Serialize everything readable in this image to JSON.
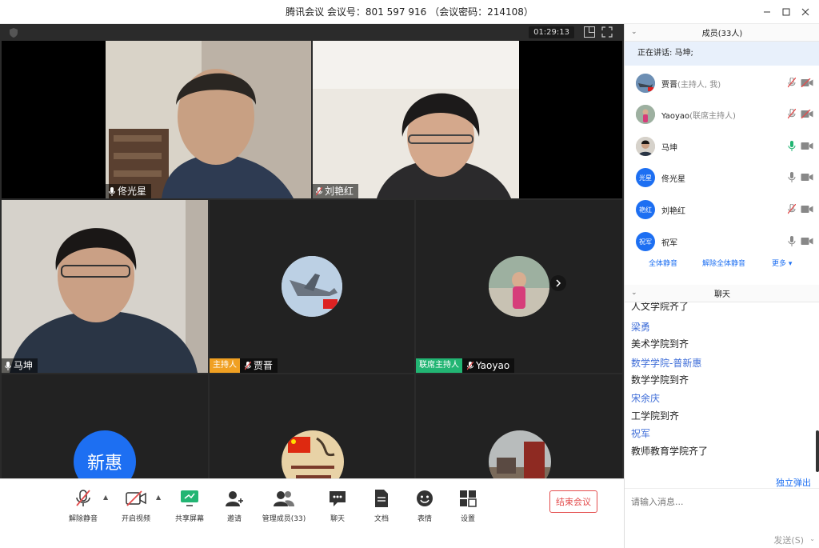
{
  "window": {
    "title": "腾讯会议 会议号：801 597 916 （会议密码：214108）"
  },
  "stage": {
    "timer": "01:29:13"
  },
  "tiles": [
    {
      "id": "tongguangxing",
      "name": "佟光星",
      "mic": "on",
      "role": ""
    },
    {
      "id": "liuyanhong",
      "name": "刘艳红",
      "mic": "muted",
      "role": ""
    },
    {
      "id": "makun",
      "name": "马坤",
      "mic": "on",
      "role": ""
    },
    {
      "id": "jiajin",
      "name": "贾晋",
      "mic": "muted",
      "role": "主持人"
    },
    {
      "id": "yaoyao",
      "name": "Yaoyao",
      "mic": "muted",
      "role": "联席主持人"
    },
    {
      "id": "xinhui",
      "avatar_text": "新惠"
    }
  ],
  "toolbar": {
    "unmute": "解除静音",
    "start_video": "开启视频",
    "share_screen": "共享屏幕",
    "invite": "邀请",
    "manage_members": "管理成员(33)",
    "chat": "聊天",
    "docs": "文档",
    "reactions": "表情",
    "settings": "设置",
    "end_meeting": "结束会议"
  },
  "members_panel": {
    "title": "成员(33人)",
    "speaking": "正在讲话: 马坤;",
    "members": [
      {
        "name": "贾晋",
        "role": "(主持人, 我)",
        "mic": "muted",
        "avatar_text": ""
      },
      {
        "name": "Yaoyao",
        "role": "(联席主持人)",
        "mic": "muted",
        "avatar_text": ""
      },
      {
        "name": "马坤",
        "role": "",
        "mic": "on",
        "avatar_text": ""
      },
      {
        "name": "佟光星",
        "role": "",
        "mic": "off",
        "avatar_text": "光星"
      },
      {
        "name": "刘艳红",
        "role": "",
        "mic": "muted",
        "avatar_text": "艳红"
      },
      {
        "name": "祝军",
        "role": "",
        "mic": "off",
        "avatar_text": "祝军"
      }
    ],
    "mute_all": "全体静音",
    "unmute_all": "解除全体静音",
    "more": "更多 ▾"
  },
  "chat_panel": {
    "title": "聊天",
    "messages": [
      {
        "sender": "",
        "text": "人文学院齐了"
      },
      {
        "sender": "梁勇",
        "text": "美术学院到齐"
      },
      {
        "sender": "数学学院-普新惠",
        "text": "数学学院到齐"
      },
      {
        "sender": "宋余庆",
        "text": "工学院到齐"
      },
      {
        "sender": "祝军",
        "text": "教师教育学院齐了"
      }
    ],
    "popout": "独立弹出",
    "placeholder": "请输入消息...",
    "send": "发送(S)"
  },
  "colors": {
    "accent": "#1d6ff2",
    "danger": "#e34c4c",
    "host": "#f0a022",
    "cohost": "#22b573",
    "stage_bg": "#2b2b2b"
  }
}
